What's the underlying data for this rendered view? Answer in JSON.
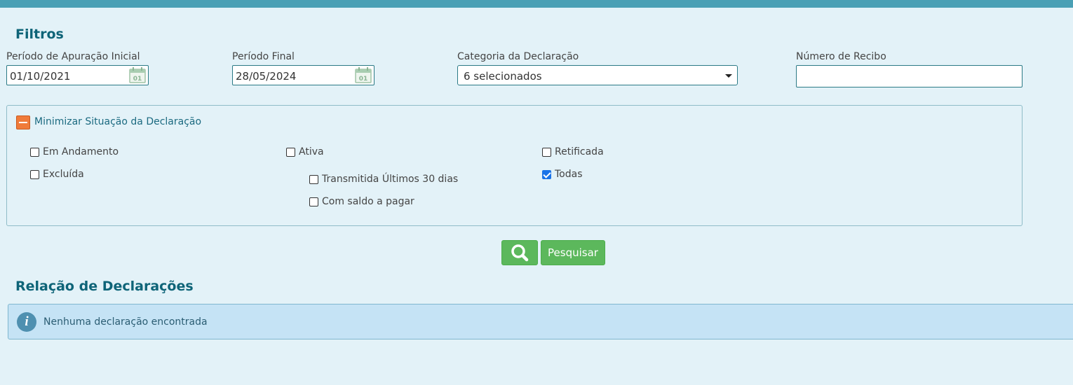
{
  "filters": {
    "title": "Filtros",
    "periodo_inicial": {
      "label": "Período de Apuração Inicial",
      "value": "01/10/2021",
      "icon": "calendar-icon"
    },
    "periodo_final": {
      "label": "Período Final",
      "value": "28/05/2024",
      "icon": "calendar-icon"
    },
    "categoria": {
      "label": "Categoria da Declaração",
      "value": "6 selecionados",
      "icon": "caret-down-icon"
    },
    "numero_recibo": {
      "label": "Número de Recibo",
      "value": ""
    },
    "calendar_day": "01"
  },
  "situacao": {
    "toggle_label": "Minimizar Situação da Declaração",
    "toggle_icon": "minus-icon",
    "options": [
      {
        "label": "Em Andamento",
        "checked": false
      },
      {
        "label": "Ativa",
        "checked": false
      },
      {
        "label": "Retificada",
        "checked": false
      },
      {
        "label": "Excluída",
        "checked": false
      },
      {
        "label": "Transmitida Últimos 30 dias",
        "checked": false
      },
      {
        "label": "Todas",
        "checked": true
      },
      {
        "label": "Com saldo a pagar",
        "checked": false
      }
    ]
  },
  "actions": {
    "search_icon": "search-icon",
    "search_label": "Pesquisar"
  },
  "results": {
    "title": "Relação de Declarações",
    "empty_message": "Nenhuma declaração encontrada",
    "info_icon": "i"
  },
  "colors": {
    "header_bar": "#4aa0b5",
    "background": "#e3f2f8",
    "title": "#0e6478",
    "button": "#5cb85c",
    "toggle": "#f07b3a",
    "alert": "#c5e3f5"
  }
}
